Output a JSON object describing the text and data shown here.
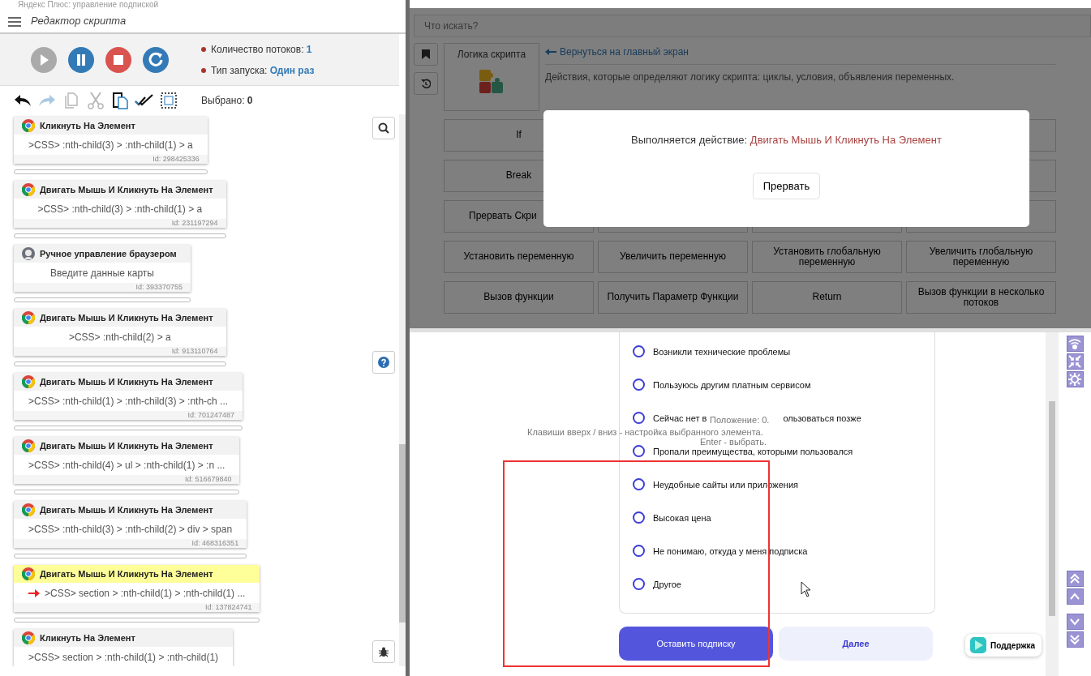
{
  "window": {
    "title": "Яндекс Плюс: управление подпиской"
  },
  "editor": {
    "title": "Редактор скрипта",
    "controls": [
      {
        "kind": "play",
        "disabled": true
      },
      {
        "kind": "pause",
        "disabled": false
      },
      {
        "kind": "stop",
        "disabled": false
      },
      {
        "kind": "restart",
        "disabled": false
      }
    ],
    "info": [
      {
        "label": "Количество потоков:",
        "value": "1"
      },
      {
        "label": "Тип запуска:",
        "value": "Один раз"
      }
    ],
    "toolbar": [
      {
        "kind": "undo",
        "disabled": false
      },
      {
        "kind": "redo",
        "disabled": true
      },
      {
        "kind": "copy",
        "disabled": true
      },
      {
        "kind": "cut",
        "disabled": true
      },
      {
        "kind": "paste",
        "disabled": false
      },
      {
        "kind": "check",
        "disabled": false
      },
      {
        "kind": "select",
        "disabled": false
      }
    ],
    "selected_label": "Выбрано:",
    "selected_count": "0",
    "actions": [
      {
        "kind": "browser",
        "title": "Кликнуть На Элемент",
        "selector": ">CSS> :nth-child(3) > :nth-child(1) > a",
        "id": "Id: 298425336",
        "current": false
      },
      {
        "kind": "browser",
        "title": "Двигать Мышь И Кликнуть На Элемент",
        "selector": ">CSS> :nth-child(3) > :nth-child(1) > a",
        "id": "Id: 231197294",
        "current": false
      },
      {
        "kind": "manual",
        "title": "Ручное управление браузером",
        "selector": "Введите данные карты",
        "id": "Id: 393370755",
        "current": false
      },
      {
        "kind": "browser",
        "title": "Двигать Мышь И Кликнуть На Элемент",
        "selector": ">CSS> :nth-child(2) > a",
        "id": "Id: 913110764",
        "current": false
      },
      {
        "kind": "browser",
        "title": "Двигать Мышь И Кликнуть На Элемент",
        "selector": ">CSS> :nth-child(1) > :nth-child(3) > :nth-ch ...",
        "id": "Id: 701247487",
        "current": false
      },
      {
        "kind": "browser",
        "title": "Двигать Мышь И Кликнуть На Элемент",
        "selector": ">CSS> :nth-child(4) > ul > :nth-child(1) > :n ...",
        "id": "Id: 516679840",
        "current": false
      },
      {
        "kind": "browser",
        "title": "Двигать Мышь И Кликнуть На Элемент",
        "selector": ">CSS> :nth-child(3) > :nth-child(2) > div > span",
        "id": "Id: 468316351",
        "current": false
      },
      {
        "kind": "browser",
        "title": "Двигать Мышь И Кликнуть На Элемент",
        "selector": ">CSS> section > :nth-child(1) > :nth-child(1) ...",
        "id": "Id: 137824741",
        "current": true
      },
      {
        "kind": "browser",
        "title": "Кликнуть На Элемент",
        "selector": ">CSS> section > :nth-child(1) > :nth-child(1)",
        "current": false
      }
    ]
  },
  "palette": {
    "search": {
      "placeholder": "Что искать?"
    },
    "category": "Логика скрипта",
    "back_link": "Вернуться на главный экран",
    "description": "Действия, которые определяют логику скрипта: циклы, условия, объявления переменных.",
    "buttons": [
      {
        "kind": "action",
        "label": "If"
      },
      {
        "kind": "hidden"
      },
      {
        "kind": "hidden"
      },
      {
        "kind": "covered"
      },
      {
        "kind": "action",
        "label": "Break"
      },
      {
        "kind": "hidden"
      },
      {
        "kind": "hidden"
      },
      {
        "kind": "covered"
      },
      {
        "kind": "cut",
        "label": "Прервать Скри"
      },
      {
        "kind": "covered"
      },
      {
        "kind": "covered"
      },
      {
        "kind": "covered"
      },
      {
        "kind": "action",
        "label": "Установить переменную"
      },
      {
        "kind": "action",
        "label": "Увеличить переменную"
      },
      {
        "kind": "action",
        "label": "Установить глобальную переменную"
      },
      {
        "kind": "action",
        "label": "Увеличить глобальную переменную"
      },
      {
        "kind": "action",
        "label": "Вызов функции"
      },
      {
        "kind": "action",
        "label": "Получить Параметр Функции"
      },
      {
        "kind": "action",
        "label": "Return"
      },
      {
        "kind": "action",
        "label": "Вызов функции в несколько потоков"
      }
    ]
  },
  "dialog": {
    "message": "Выполняется действие:",
    "action": "Двигать Мышь И Кликнуть На Элемент",
    "button": "Прервать"
  },
  "page": {
    "options": [
      {
        "label": "Возникли технические проблемы",
        "selected": false
      },
      {
        "label": "Пользуюсь другим платным сервисом",
        "selected": false
      },
      {
        "label": "Сейчас нет в",
        "label_end": "ользоваться позже",
        "selected": false
      },
      {
        "label": "Пропали преимущества, которыми пользовался",
        "selected": false
      },
      {
        "label": "Неудобные сайты или приложения",
        "selected": false
      },
      {
        "label": "Высокая цена",
        "selected": false
      },
      {
        "label": "Не понимаю, откуда у меня подписка",
        "selected": false
      },
      {
        "label": "Другое",
        "selected": false
      }
    ],
    "buttons": [
      {
        "kind": "primary",
        "label": "Оставить подписку"
      },
      {
        "kind": "secondary",
        "label": "Далее"
      }
    ],
    "support": "Поддержка"
  },
  "hints": {
    "position": "Положение: 0.",
    "keys": "Клавиши вверх / вниз - настройка выбранного элемента.",
    "enter": "Enter - выбрать."
  }
}
